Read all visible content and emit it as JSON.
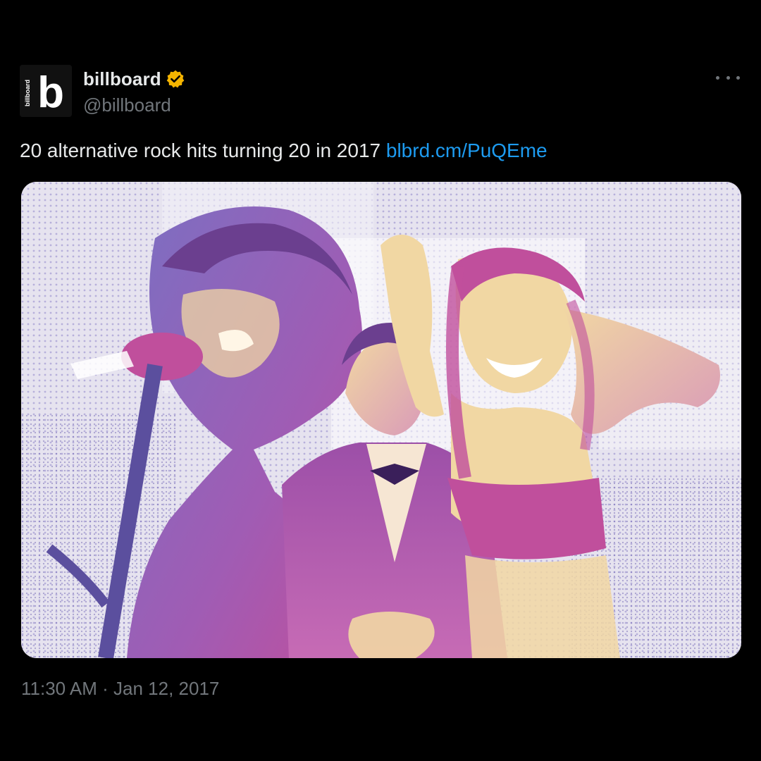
{
  "account": {
    "display_name": "billboard",
    "handle": "@billboard",
    "avatar_letter": "b",
    "avatar_side_text": "billboard",
    "verified_icon": "verified-badge-icon",
    "verified_color": "#f4b400"
  },
  "tweet": {
    "text": "20 alternative rock hits turning 20 in 2017 ",
    "link": "blbrd.cm/PuQEme",
    "link_color": "#1d9bf0",
    "timestamp": "11:30 AM · Jan 12, 2017"
  },
  "menu": {
    "icon": "more-options-icon"
  },
  "media": {
    "palette": [
      "#e6e3ef",
      "#8f86c9",
      "#c04f9c",
      "#f1d7a3",
      "#6b5fb0"
    ]
  }
}
